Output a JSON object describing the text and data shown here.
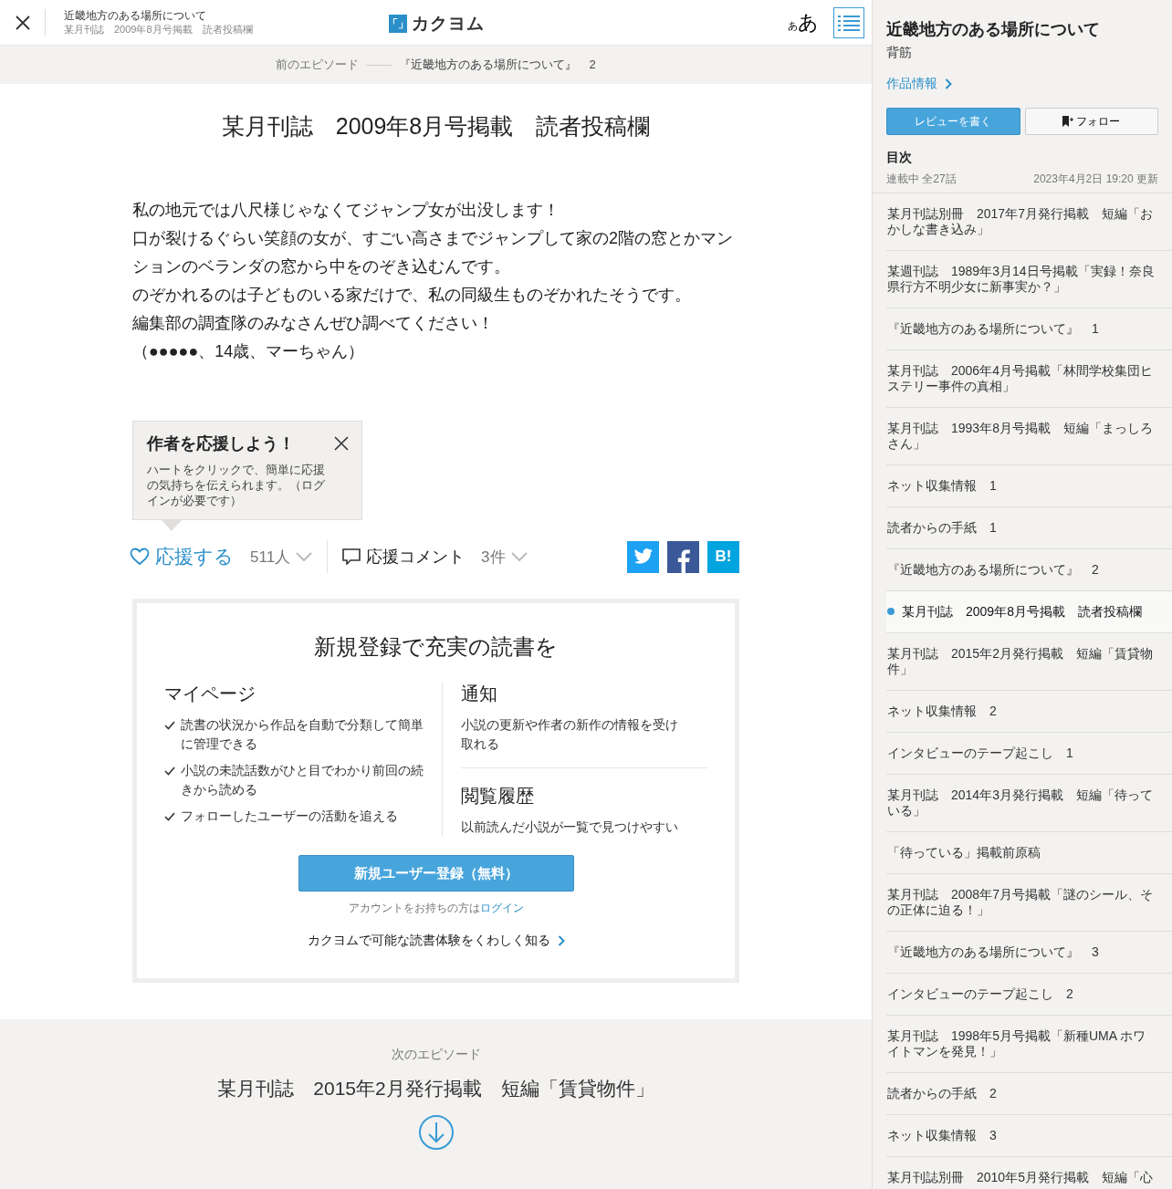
{
  "header": {
    "work_title": "近畿地方のある場所について",
    "episode_title": "某月刊誌　2009年8月号掲載　読者投稿欄",
    "logo_mark": "「」",
    "logo_text": "カクヨム",
    "font_small": "あ",
    "font_large": "あ"
  },
  "prev_episode": {
    "label": "前のエピソード",
    "title": "『近畿地方のある場所について』　2"
  },
  "episode": {
    "title": "某月刊誌　2009年8月号掲載　読者投稿欄",
    "paragraphs": [
      "私の地元では八尺様じゃなくてジャンプ女が出没します！",
      "口が裂けるぐらい笑顔の女が、すごい高さまでジャンプして家の2階の窓とかマンションのベランダの窓から中をのぞき込むんです。",
      "のぞかれるのは子どものいる家だけで、私の同級生ものぞかれたそうです。",
      "編集部の調査隊のみなさんぜひ調べてください！",
      "（●●●●●、14歳、マーちゃん）"
    ]
  },
  "tooltip": {
    "title": "作者を応援しよう！",
    "text": "ハートをクリックで、簡単に応援の気持ちを伝えられます。（ログインが必要です）"
  },
  "actions": {
    "cheer": "応援する",
    "cheer_count": "511人",
    "comment": "応援コメント",
    "comment_count": "3件",
    "hatena": "B!"
  },
  "signup": {
    "title": "新規登録で充実の読書を",
    "mypage_title": "マイページ",
    "mypage_items": [
      "読書の状況から作品を自動で分類して簡単に管理できる",
      "小説の未読話数がひと目でわかり前回の続きから読める",
      "フォローしたユーザーの活動を追える"
    ],
    "notice_title": "通知",
    "notice_text": "小説の更新や作者の新作の情報を受け取れる",
    "history_title": "閲覧履歴",
    "history_text": "以前読んだ小説が一覧で見つけやすい",
    "button": "新規ユーザー登録（無料）",
    "account_text": "アカウントをお持ちの方は",
    "login": "ログイン",
    "learn_more": "カクヨムで可能な読書体験をくわしく知る"
  },
  "next_episode": {
    "label": "次のエピソード",
    "title": "某月刊誌　2015年2月発行掲載　短編「賃貸物件」"
  },
  "sidebar": {
    "title": "近畿地方のある場所について",
    "author": "背筋",
    "info_link": "作品情報",
    "review_button": "レビューを書く",
    "follow_button": "フォロー",
    "toc_title": "目次",
    "status": "連載中 全27話",
    "updated": "2023年4月2日 19:20 更新",
    "items": [
      {
        "title": "某月刊誌別冊　2017年7月発行掲載　短編「おかしな書き込み」",
        "selected": false
      },
      {
        "title": "某週刊誌　1989年3月14日号掲載「実録！奈良県行方不明少女に新事実か？」",
        "selected": false
      },
      {
        "title": "『近畿地方のある場所について』　1",
        "selected": false
      },
      {
        "title": "某月刊誌　2006年4月号掲載「林間学校集団ヒステリー事件の真相」",
        "selected": false
      },
      {
        "title": "某月刊誌　1993年8月号掲載　短編「まっしろさん」",
        "selected": false
      },
      {
        "title": "ネット収集情報　1",
        "selected": false
      },
      {
        "title": "読者からの手紙　1",
        "selected": false
      },
      {
        "title": "『近畿地方のある場所について』　2",
        "selected": false
      },
      {
        "title": "某月刊誌　2009年8月号掲載　読者投稿欄",
        "selected": true
      },
      {
        "title": "某月刊誌　2015年2月発行掲載　短編「賃貸物件」",
        "selected": false
      },
      {
        "title": "ネット収集情報　2",
        "selected": false
      },
      {
        "title": "インタビューのテープ起こし　1",
        "selected": false
      },
      {
        "title": "某月刊誌　2014年3月発行掲載　短編「待っている」",
        "selected": false
      },
      {
        "title": "「待っている」掲載前原稿",
        "selected": false
      },
      {
        "title": "某月刊誌　2008年7月号掲載「謎のシール、その正体に迫る！」",
        "selected": false
      },
      {
        "title": "『近畿地方のある場所について』　3",
        "selected": false
      },
      {
        "title": "インタビューのテープ起こし　2",
        "selected": false
      },
      {
        "title": "某月刊誌　1998年5月号掲載「新種UMA ホワイトマンを発見！」",
        "selected": false
      },
      {
        "title": "読者からの手紙　2",
        "selected": false
      },
      {
        "title": "ネット収集情報　3",
        "selected": false
      },
      {
        "title": "某月刊誌別冊　2010年5月発行掲載　短編「心",
        "selected": false
      }
    ]
  }
}
